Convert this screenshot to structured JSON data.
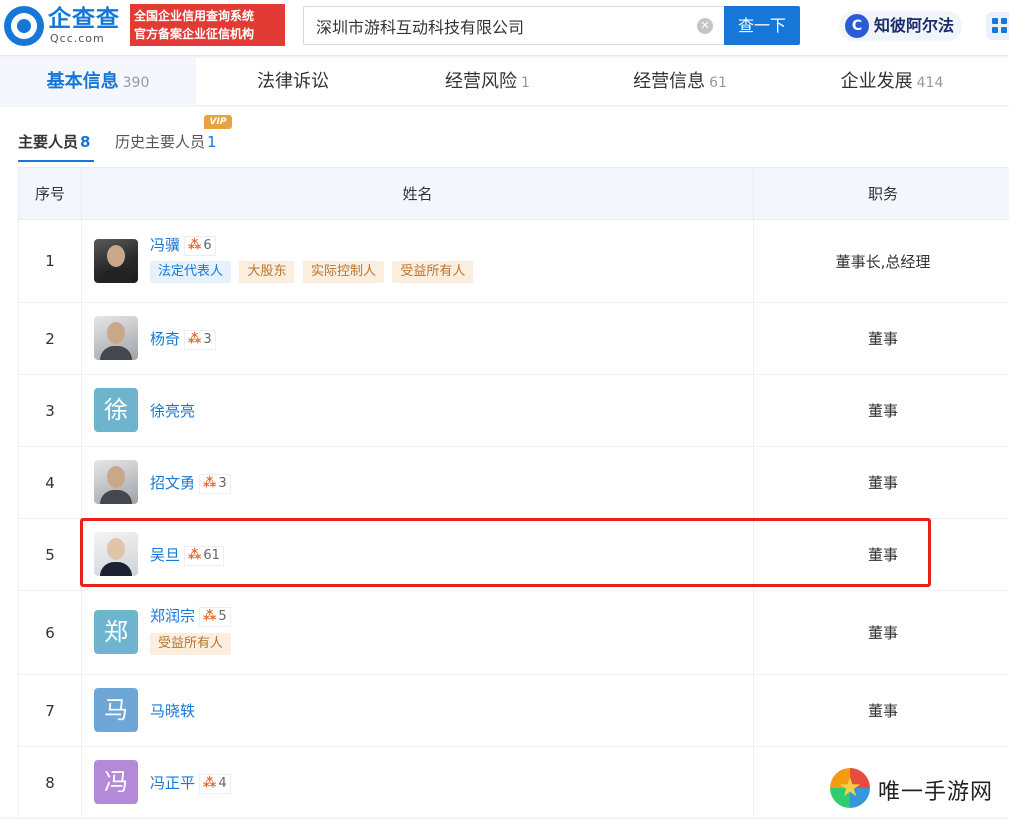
{
  "header": {
    "logo_cn": "企查查",
    "logo_en": "Qcc.com",
    "slogan_line1": "全国企业信用查询系统",
    "slogan_line2": "官方备案企业征信机构",
    "search_value": "深圳市游科互动科技有限公司",
    "search_button": "查一下",
    "zbaf_label": "知彼阿尔法"
  },
  "tabs": [
    {
      "label": "基本信息",
      "count": "390"
    },
    {
      "label": "法律诉讼",
      "count": ""
    },
    {
      "label": "经营风险",
      "count": "1"
    },
    {
      "label": "经营信息",
      "count": "61"
    },
    {
      "label": "企业发展",
      "count": "414"
    }
  ],
  "subtabs": {
    "current_label": "主要人员",
    "current_count": "8",
    "history_label": "历史主要人员",
    "history_count": "1",
    "vip": "VIP"
  },
  "table": {
    "headers": {
      "no": "序号",
      "name": "姓名",
      "role": "职务"
    },
    "rows": [
      {
        "no": "1",
        "name": "冯骥",
        "relations": "6",
        "tags": [
          "法定代表人",
          "大股东",
          "实际控制人",
          "受益所有人"
        ],
        "role": "董事长,总经理"
      },
      {
        "no": "2",
        "name": "杨奇",
        "relations": "3",
        "tags": [],
        "role": "董事"
      },
      {
        "no": "3",
        "name": "徐亮亮",
        "avatar_char": "徐",
        "relations": "",
        "tags": [],
        "role": "董事"
      },
      {
        "no": "4",
        "name": "招文勇",
        "relations": "3",
        "tags": [],
        "role": "董事"
      },
      {
        "no": "5",
        "name": "吴旦",
        "relations": "61",
        "tags": [],
        "role": "董事"
      },
      {
        "no": "6",
        "name": "郑润宗",
        "avatar_char": "郑",
        "relations": "5",
        "tags": [
          "受益所有人"
        ],
        "role": "董事"
      },
      {
        "no": "7",
        "name": "马晓轶",
        "avatar_char": "马",
        "relations": "",
        "tags": [],
        "role": "董事"
      },
      {
        "no": "8",
        "name": "冯正平",
        "avatar_char": "冯",
        "relations": "4",
        "tags": [],
        "role": "董事"
      }
    ]
  },
  "watermark": "唯一手游网",
  "colors": {
    "brand": "#1677d9",
    "highlight": "#e81f1f",
    "slogan_bg": "#e23b35"
  }
}
